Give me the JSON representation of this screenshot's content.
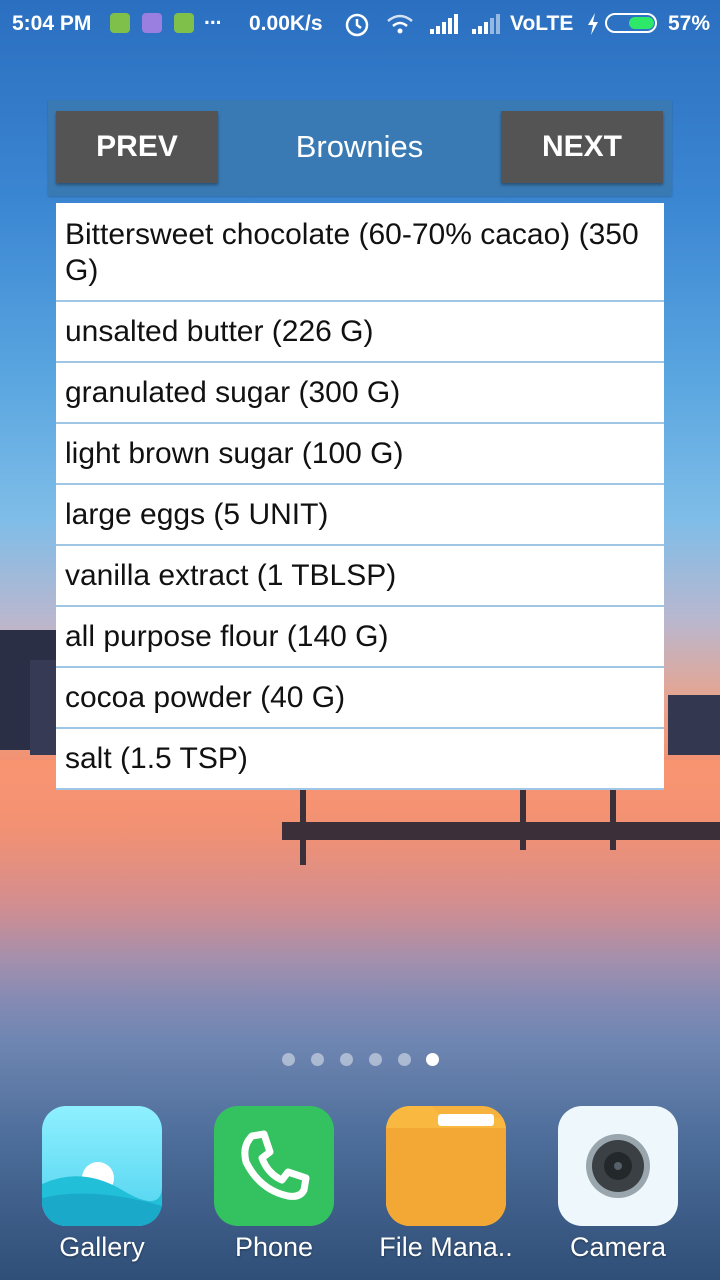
{
  "status_bar": {
    "time": "5:04 PM",
    "dots": "...",
    "net_speed": "0.00K/s",
    "volte": "VoLTE",
    "battery_percent": "57%",
    "battery_level": 0.57
  },
  "widget": {
    "prev_label": "PREV",
    "title": "Brownies",
    "next_label": "NEXT",
    "ingredients": [
      "Bittersweet chocolate (60-70% cacao) (350 G)",
      "unsalted butter (226 G)",
      "granulated sugar (300 G)",
      "light brown sugar (100 G)",
      "large eggs (5 UNIT)",
      "vanilla extract (1 TBLSP)",
      "all purpose flour (140 G)",
      "cocoa powder (40 G)",
      "salt (1.5 TSP)"
    ]
  },
  "page_indicator": {
    "count": 6,
    "active_index": 5
  },
  "dock": {
    "apps": [
      {
        "label": "Gallery",
        "icon": "gallery-icon"
      },
      {
        "label": "Phone",
        "icon": "phone-icon"
      },
      {
        "label": "File Mana..",
        "icon": "file-manager-icon"
      },
      {
        "label": "Camera",
        "icon": "camera-icon"
      }
    ]
  },
  "colors": {
    "header_bg": "#3a7ab4",
    "button_bg": "#545454",
    "divider": "#9fc6e4",
    "battery_fill": "#2ee86a"
  }
}
